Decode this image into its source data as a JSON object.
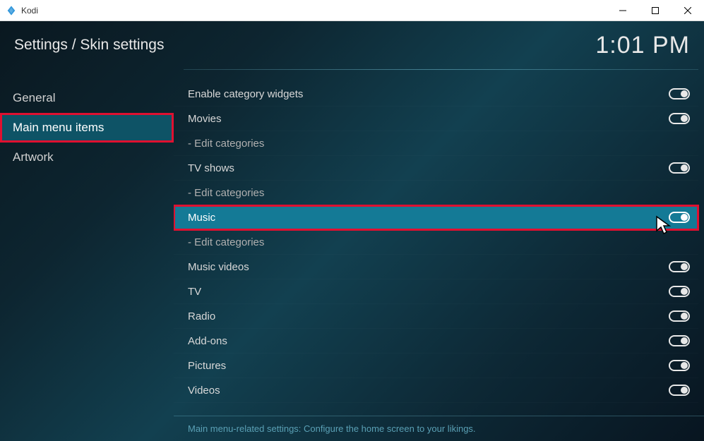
{
  "titlebar": {
    "app_name": "Kodi"
  },
  "header": {
    "breadcrumb": "Settings / Skin settings",
    "clock": "1:01 PM"
  },
  "sidebar": {
    "items": [
      {
        "label": "General",
        "selected": false,
        "highlighted": false
      },
      {
        "label": "Main menu items",
        "selected": true,
        "highlighted": true
      },
      {
        "label": "Artwork",
        "selected": false,
        "highlighted": false
      }
    ]
  },
  "settings": [
    {
      "label": "Enable category widgets",
      "toggle": "on",
      "sub": false,
      "selected": false,
      "highlighted": false
    },
    {
      "label": "Movies",
      "toggle": "on",
      "sub": false,
      "selected": false,
      "highlighted": false
    },
    {
      "label": "- Edit categories",
      "toggle": null,
      "sub": true,
      "selected": false,
      "highlighted": false
    },
    {
      "label": "TV shows",
      "toggle": "on",
      "sub": false,
      "selected": false,
      "highlighted": false
    },
    {
      "label": "- Edit categories",
      "toggle": null,
      "sub": true,
      "selected": false,
      "highlighted": false
    },
    {
      "label": "Music",
      "toggle": "on",
      "sub": false,
      "selected": true,
      "highlighted": true
    },
    {
      "label": "- Edit categories",
      "toggle": null,
      "sub": true,
      "selected": false,
      "highlighted": false
    },
    {
      "label": "Music videos",
      "toggle": "on",
      "sub": false,
      "selected": false,
      "highlighted": false
    },
    {
      "label": "TV",
      "toggle": "on",
      "sub": false,
      "selected": false,
      "highlighted": false
    },
    {
      "label": "Radio",
      "toggle": "on",
      "sub": false,
      "selected": false,
      "highlighted": false
    },
    {
      "label": "Add-ons",
      "toggle": "on",
      "sub": false,
      "selected": false,
      "highlighted": false
    },
    {
      "label": "Pictures",
      "toggle": "on",
      "sub": false,
      "selected": false,
      "highlighted": false
    },
    {
      "label": "Videos",
      "toggle": "on",
      "sub": false,
      "selected": false,
      "highlighted": false
    }
  ],
  "footer": {
    "text": "Main menu-related settings: Configure the home screen to your likings."
  }
}
